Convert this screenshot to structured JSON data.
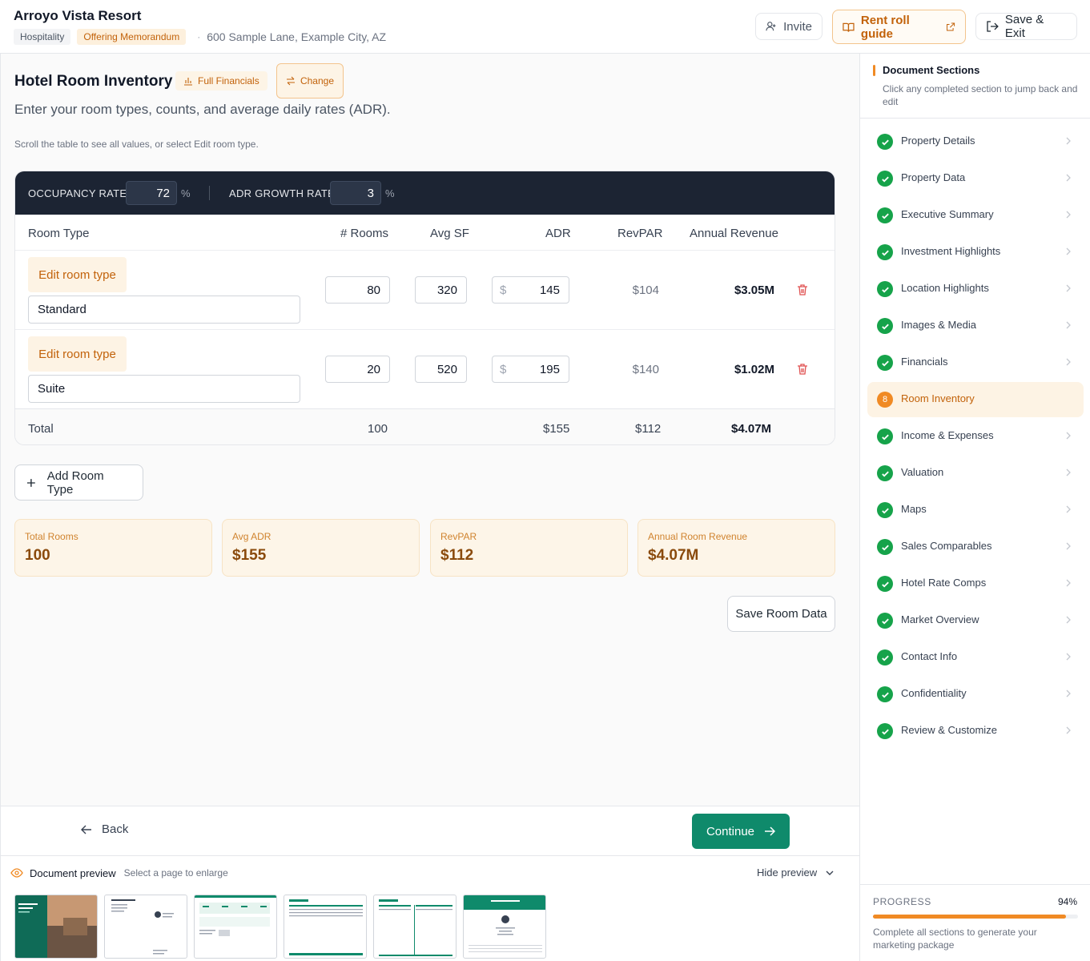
{
  "header": {
    "property_name": "Arroyo Vista Resort",
    "tag_type": "Hospitality",
    "tag_doc": "Offering Memorandum",
    "address": "600 Sample Lane, Example City, AZ",
    "invite_label": "Invite",
    "guide_label": "Rent roll guide",
    "save_exit_label": "Save & Exit"
  },
  "section": {
    "title": "Hotel Room Inventory",
    "full_financials": "Full Financials",
    "change": "Change",
    "subtitle": "Enter your room types, counts, and average daily rates (ADR).",
    "hint": "Scroll the table to see all values, or select Edit room type."
  },
  "rates": {
    "occupancy_label": "OCCUPANCY RATE",
    "occupancy_value": "72",
    "adr_growth_label": "ADR GROWTH RATE",
    "adr_growth_value": "3",
    "unit": "%"
  },
  "table": {
    "headers": {
      "room_type": "Room Type",
      "rooms": "# Rooms",
      "avg_sf": "Avg SF",
      "adr": "ADR",
      "revpar": "RevPAR",
      "annual": "Annual Revenue"
    },
    "edit_label": "Edit room type",
    "currency": "$",
    "rows": [
      {
        "name": "Standard",
        "rooms": "80",
        "sf": "320",
        "adr": "145",
        "revpar": "$104",
        "annual": "$3.05M"
      },
      {
        "name": "Suite",
        "rooms": "20",
        "sf": "520",
        "adr": "195",
        "revpar": "$140",
        "annual": "$1.02M"
      }
    ],
    "total": {
      "label": "Total",
      "rooms": "100",
      "adr": "$155",
      "revpar": "$112",
      "annual": "$4.07M"
    }
  },
  "add_room_label": "Add Room Type",
  "stats": [
    {
      "label": "Total Rooms",
      "value": "100"
    },
    {
      "label": "Avg ADR",
      "value": "$155"
    },
    {
      "label": "RevPAR",
      "value": "$112"
    },
    {
      "label": "Annual Room Revenue",
      "value": "$4.07M"
    }
  ],
  "save_room_label": "Save Room Data",
  "nav": {
    "back": "Back",
    "continue": "Continue"
  },
  "preview": {
    "title": "Document preview",
    "subtitle": "Select a page to enlarge",
    "hide": "Hide preview",
    "thumbnails": [
      "cover-page",
      "summary-page",
      "highlights-page",
      "financials-page",
      "rent-roll-page",
      "contact-page"
    ]
  },
  "sidebar": {
    "title": "Document Sections",
    "subtitle": "Click any completed section to jump back and edit",
    "items": [
      {
        "label": "Property Details",
        "state": "done"
      },
      {
        "label": "Property Data",
        "state": "done"
      },
      {
        "label": "Executive Summary",
        "state": "done"
      },
      {
        "label": "Investment Highlights",
        "state": "done"
      },
      {
        "label": "Location Highlights",
        "state": "done"
      },
      {
        "label": "Images & Media",
        "state": "done"
      },
      {
        "label": "Financials",
        "state": "done"
      },
      {
        "label": "Room Inventory",
        "state": "active",
        "step": "8"
      },
      {
        "label": "Income & Expenses",
        "state": "done"
      },
      {
        "label": "Valuation",
        "state": "done"
      },
      {
        "label": "Maps",
        "state": "done"
      },
      {
        "label": "Sales Comparables",
        "state": "done"
      },
      {
        "label": "Hotel Rate Comps",
        "state": "done"
      },
      {
        "label": "Market Overview",
        "state": "done"
      },
      {
        "label": "Contact Info",
        "state": "done"
      },
      {
        "label": "Confidentiality",
        "state": "done"
      },
      {
        "label": "Review & Customize",
        "state": "done"
      }
    ],
    "progress_label": "PROGRESS",
    "progress_value": "94%",
    "progress_fraction": 0.94,
    "progress_note": "Complete all sections to generate your marketing package"
  },
  "colors": {
    "accent": "#f08a24",
    "primary": "#0f8a6b",
    "success": "#16a34a",
    "dark_bar": "#1c2433"
  }
}
